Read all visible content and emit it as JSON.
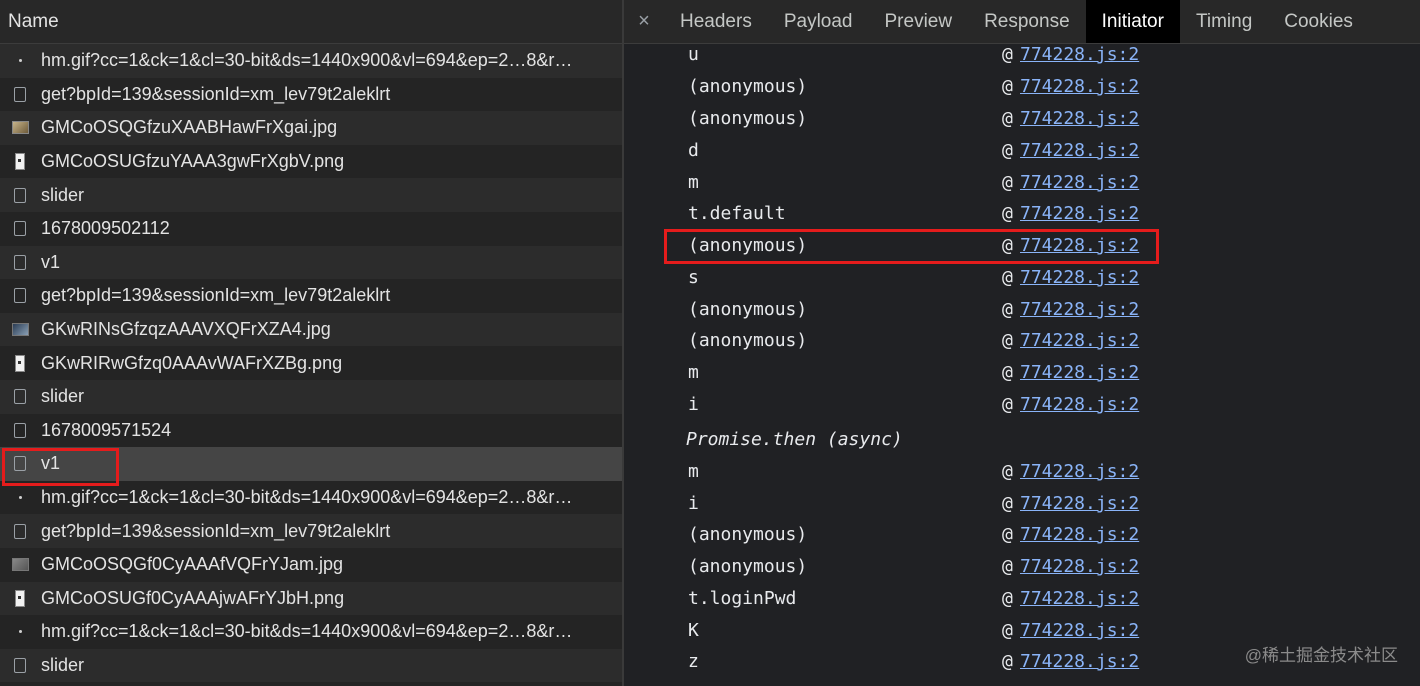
{
  "network": {
    "name_header": "Name",
    "requests": [
      {
        "name": "hm.gif?cc=1&ck=1&cl=30-bit&ds=1440x900&vl=694&ep=2…8&r…",
        "icon": "dot-icon"
      },
      {
        "name": "get?bpId=139&sessionId=xm_lev79t2aleklrt",
        "icon": "checkbox-icon"
      },
      {
        "name": "GMCoOSQGfzuXAABHawFrXgai.jpg",
        "icon": "image-thumbnail-icon"
      },
      {
        "name": "GMCoOSUGfzuYAAA3gwFrXgbV.png",
        "icon": "image-portrait-icon"
      },
      {
        "name": "slider",
        "icon": "checkbox-icon"
      },
      {
        "name": "1678009502112",
        "icon": "checkbox-icon"
      },
      {
        "name": "v1",
        "icon": "checkbox-icon"
      },
      {
        "name": "get?bpId=139&sessionId=xm_lev79t2aleklrt",
        "icon": "checkbox-icon"
      },
      {
        "name": "GKwRINsGfzqzAAAVXQFrXZA4.jpg",
        "icon": "image-thumbnail-icon"
      },
      {
        "name": "GKwRIRwGfzq0AAAvWAFrXZBg.png",
        "icon": "image-portrait-icon"
      },
      {
        "name": "slider",
        "icon": "checkbox-icon"
      },
      {
        "name": "1678009571524",
        "icon": "checkbox-icon"
      },
      {
        "name": "v1",
        "icon": "checkbox-icon"
      },
      {
        "name": "hm.gif?cc=1&ck=1&cl=30-bit&ds=1440x900&vl=694&ep=2…8&r…",
        "icon": "dot-icon"
      },
      {
        "name": "get?bpId=139&sessionId=xm_lev79t2aleklrt",
        "icon": "checkbox-icon"
      },
      {
        "name": "GMCoOSQGf0CyAAAfVQFrYJam.jpg",
        "icon": "image-thumbnail-icon"
      },
      {
        "name": "GMCoOSUGf0CyAAAjwAFrYJbH.png",
        "icon": "image-portrait-icon"
      },
      {
        "name": "hm.gif?cc=1&ck=1&cl=30-bit&ds=1440x900&vl=694&ep=2…8&r…",
        "icon": "dot-icon"
      },
      {
        "name": "slider",
        "icon": "checkbox-icon"
      }
    ]
  },
  "details": {
    "close_symbol": "×",
    "tabs": [
      "Headers",
      "Payload",
      "Preview",
      "Response",
      "Initiator",
      "Timing",
      "Cookies"
    ],
    "active_tab": "Initiator",
    "call_stack": [
      {
        "fn": "u",
        "at": "@",
        "link": "774228.js:2"
      },
      {
        "fn": "(anonymous)",
        "at": "@",
        "link": "774228.js:2"
      },
      {
        "fn": "(anonymous)",
        "at": "@",
        "link": "774228.js:2"
      },
      {
        "fn": "d",
        "at": "@",
        "link": "774228.js:2"
      },
      {
        "fn": "m",
        "at": "@",
        "link": "774228.js:2"
      },
      {
        "fn": "t.default",
        "at": "@",
        "link": "774228.js:2"
      },
      {
        "fn": "(anonymous)",
        "at": "@",
        "link": "774228.js:2"
      },
      {
        "fn": "s",
        "at": "@",
        "link": "774228.js:2"
      },
      {
        "fn": "(anonymous)",
        "at": "@",
        "link": "774228.js:2"
      },
      {
        "fn": "(anonymous)",
        "at": "@",
        "link": "774228.js:2"
      },
      {
        "fn": "m",
        "at": "@",
        "link": "774228.js:2"
      },
      {
        "fn": "i",
        "at": "@",
        "link": "774228.js:2"
      },
      {
        "async": "Promise.then (async)"
      },
      {
        "fn": "m",
        "at": "@",
        "link": "774228.js:2"
      },
      {
        "fn": "i",
        "at": "@",
        "link": "774228.js:2"
      },
      {
        "fn": "(anonymous)",
        "at": "@",
        "link": "774228.js:2"
      },
      {
        "fn": "(anonymous)",
        "at": "@",
        "link": "774228.js:2"
      },
      {
        "fn": "t.loginPwd",
        "at": "@",
        "link": "774228.js:2"
      },
      {
        "fn": "K",
        "at": "@",
        "link": "774228.js:2"
      },
      {
        "fn": "z",
        "at": "@",
        "link": "774228.js:2"
      }
    ]
  },
  "watermark": "@稀土掘金技术社区",
  "colors": {
    "highlight": "#e51c1c",
    "link": "#8ab4f8",
    "selected_row": "#454545"
  }
}
